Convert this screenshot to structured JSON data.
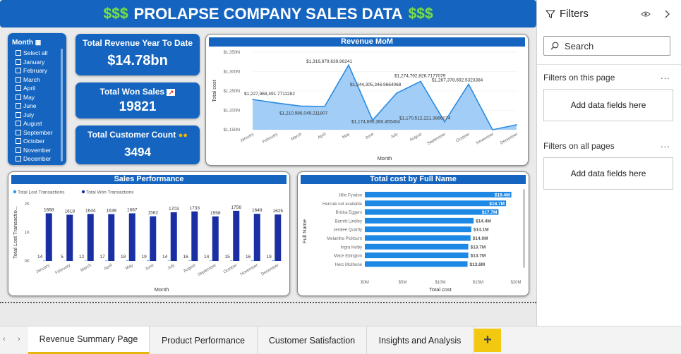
{
  "banner": {
    "dollar_icon": "$$$",
    "title": "PROLAPSE COMPANY SALES DATA"
  },
  "month_slicer": {
    "title": "Month",
    "items": [
      "Select all",
      "January",
      "February",
      "March",
      "April",
      "May",
      "June",
      "July",
      "August",
      "September",
      "October",
      "November",
      "December"
    ]
  },
  "kpis": {
    "revenue": {
      "label": "Total Revenue Year To Date",
      "value": "$14.78bn"
    },
    "won_sales": {
      "label": "Total Won Sales",
      "value": "19821"
    },
    "customers": {
      "label": "Total Customer Count",
      "value": "3494"
    }
  },
  "chart_data": [
    {
      "type": "area",
      "title": "Revenue MoM",
      "ylabel": "Total cost",
      "xlabel": "Month",
      "yticks": [
        "$1,150M",
        "$1,200M",
        "$1,250M",
        "$1,300M",
        "$1,350M"
      ],
      "ylim": [
        1150,
        1350
      ],
      "categories": [
        "January",
        "February",
        "March",
        "April",
        "May",
        "June",
        "July",
        "August",
        "September",
        "October",
        "November",
        "December"
      ],
      "values": [
        1227.97,
        1219,
        1210.99,
        1210,
        1316.88,
        1174.69,
        1244.31,
        1274.79,
        1170.51,
        1267.38,
        1150,
        1163
      ],
      "data_labels": [
        "$1,227,968,491.7711282",
        "$1,210,986,049.211807",
        "$1,316,879,639.86241",
        "$1,174,690,360.455404",
        "$1,244,305,346.9664068",
        "$1,274,792,826.7177079",
        "$1,170,512,221.3866074",
        "$1,267,378,692.5323384"
      ]
    },
    {
      "type": "bar",
      "title": "Sales Performance",
      "ylabel": "Total Lost Transactio...",
      "xlabel": "Month",
      "yticks": [
        "0K",
        "1K",
        "2K"
      ],
      "ylim": [
        0,
        2000
      ],
      "categories": [
        "January",
        "February",
        "March",
        "April",
        "May",
        "June",
        "July",
        "August",
        "September",
        "October",
        "November",
        "December"
      ],
      "series": [
        {
          "name": "Total Lost Transactions",
          "values": [
            14,
            5,
            12,
            17,
            18,
            19,
            14,
            16,
            14,
            15,
            16,
            19
          ]
        },
        {
          "name": "Total Won Transactions",
          "values": [
            1668,
            1618,
            1644,
            1638,
            1667,
            1562,
            1703,
            1733,
            1558,
            1756,
            1649,
            1625
          ]
        }
      ]
    },
    {
      "type": "bar",
      "title": "Total cost by Full Name",
      "ylabel": "Full Name",
      "xlabel": "Total cost",
      "xticks": [
        "$0M",
        "$5M",
        "$10M",
        "$15M",
        "$20M"
      ],
      "xlim": [
        0,
        20
      ],
      "categories": [
        "Jillie Fyndon",
        "Hercule not available",
        "Bricka Eggers",
        "Barrett Lindley",
        "Jeralee Quartly",
        "Melantha Pickburn",
        "Ingra Kelby",
        "Mace Edington",
        "Herc Mcilhone"
      ],
      "values": [
        19.4,
        18.7,
        17.7,
        14.4,
        14.1,
        14.0,
        13.7,
        13.7,
        13.6
      ],
      "value_labels": [
        "$19.4M",
        "$18.7M",
        "$17.7M",
        "$14.4M",
        "$14.1M",
        "$14.0M",
        "$13.7M",
        "$13.7M",
        "$13.6M"
      ]
    }
  ],
  "filters_pane": {
    "title": "Filters",
    "search_placeholder": "Search",
    "section_page": "Filters on this page",
    "section_all": "Filters on all pages",
    "add_fields": "Add data fields here",
    "more": "..."
  },
  "tabs": [
    "Revenue Summary Page",
    "Product Performance",
    "Customer Satisfaction",
    "Insights and Analysis"
  ],
  "add_tab": "+",
  "colors": {
    "brand": "#1565c0",
    "area": "#90c4f5",
    "line": "#2a8be0",
    "won": "#1a2fa3",
    "lost": "#2196f3",
    "hbar": "#1e88e5",
    "tab_accent": "#e8b50a"
  }
}
